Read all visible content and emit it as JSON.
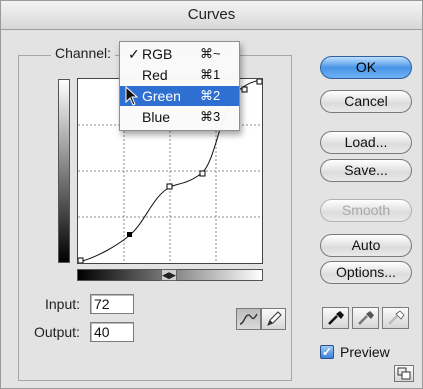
{
  "window": {
    "title": "Curves"
  },
  "channel": {
    "label": "Channel:",
    "selected": "Green",
    "menu": [
      {
        "check": "✓",
        "label": "RGB",
        "shortcut": "⌘~",
        "selected": false
      },
      {
        "check": "",
        "label": "Red",
        "shortcut": "⌘1",
        "selected": false
      },
      {
        "check": "",
        "label": "Green",
        "shortcut": "⌘2",
        "selected": true
      },
      {
        "check": "",
        "label": "Blue",
        "shortcut": "⌘3",
        "selected": false
      }
    ]
  },
  "fields": {
    "input_label": "Input:",
    "input_value": "72",
    "output_label": "Output:",
    "output_value": "40"
  },
  "buttons": {
    "ok": "OK",
    "cancel": "Cancel",
    "load": "Load...",
    "save": "Save...",
    "smooth": "Smooth",
    "auto": "Auto",
    "options": "Options..."
  },
  "preview": {
    "label": "Preview",
    "checked": true
  },
  "gradient_toggle": "◀▶",
  "icons": {
    "curve_tool": "curve-tool-icon",
    "pencil_tool": "pencil-icon",
    "black_eyedropper": "black-eyedropper-icon",
    "gray_eyedropper": "gray-eyedropper-icon",
    "white_eyedropper": "white-eyedropper-icon",
    "resize": "resize-icon"
  },
  "colors": {
    "accent": "#2f6fd1",
    "default_button": "#4a95e8"
  }
}
